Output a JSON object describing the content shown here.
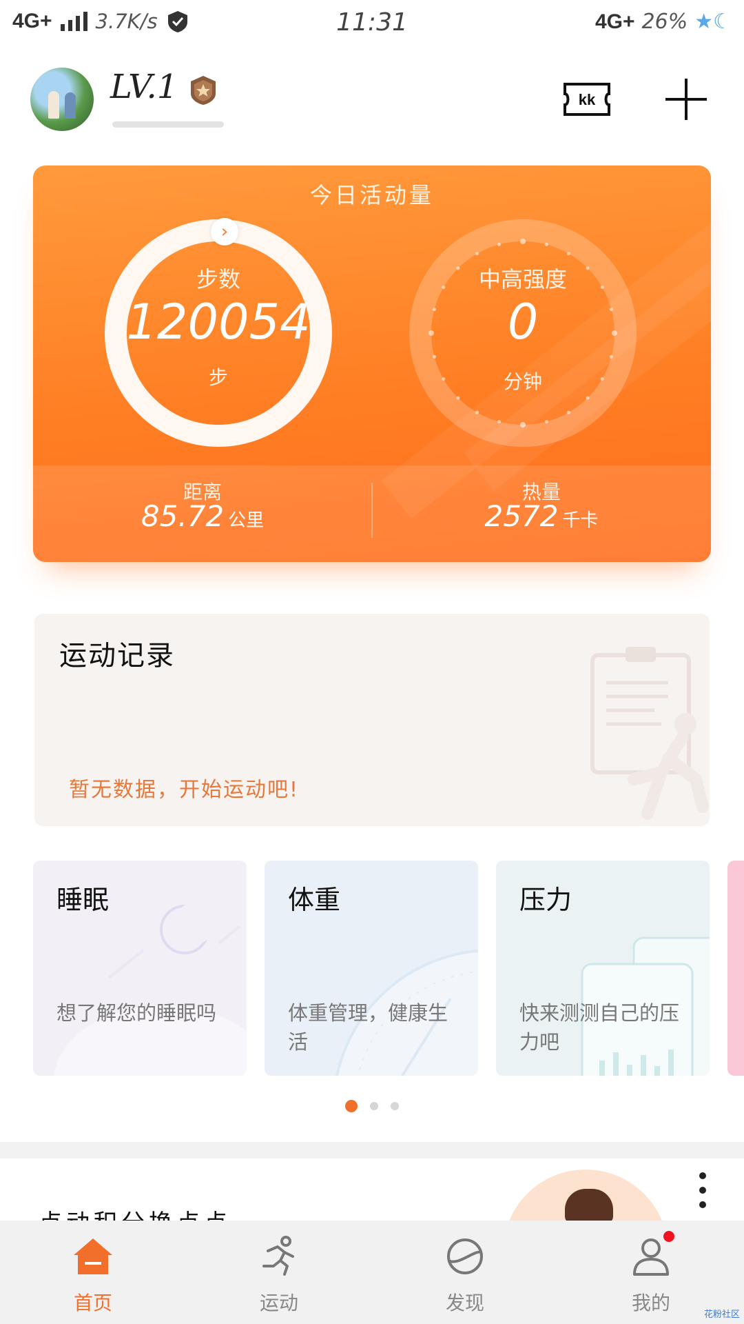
{
  "status_bar": {
    "network": "4G+",
    "speed": "3.7K/s",
    "time": "11:31",
    "network_right": "4G+",
    "battery": "26%"
  },
  "header": {
    "level": "LV.1",
    "level_progress": 0.0
  },
  "activity": {
    "title": "今日活动量",
    "steps_label": "步数",
    "steps_value": "120054",
    "steps_unit": "步",
    "intensity_label": "中高强度",
    "intensity_value": "0",
    "intensity_unit": "分钟",
    "distance_label": "距离",
    "distance_value": "85.72",
    "distance_unit": "公里",
    "calories_label": "热量",
    "calories_value": "2572",
    "calories_unit": "千卡"
  },
  "record": {
    "title": "运动记录",
    "empty_text": "暂无数据，开始运动吧!"
  },
  "features": [
    {
      "title": "睡眠",
      "desc": "想了解您的睡眠吗"
    },
    {
      "title": "体重",
      "desc": "体重管理，健康生活"
    },
    {
      "title": "压力",
      "desc": "快来测测自己的压力吧"
    }
  ],
  "pager": {
    "count": 3,
    "active": 0
  },
  "promo": {
    "title": "点动积分换点点"
  },
  "nav": [
    {
      "label": "首页",
      "icon": "home-icon",
      "active": true
    },
    {
      "label": "运动",
      "icon": "running-icon",
      "active": false
    },
    {
      "label": "发现",
      "icon": "discover-icon",
      "active": false
    },
    {
      "label": "我的",
      "icon": "profile-icon",
      "active": false
    }
  ],
  "watermark": "花粉社区",
  "colors": {
    "accent": "#f26f2b",
    "card_orange": "#ff7f24",
    "notification": "#f0141e"
  }
}
